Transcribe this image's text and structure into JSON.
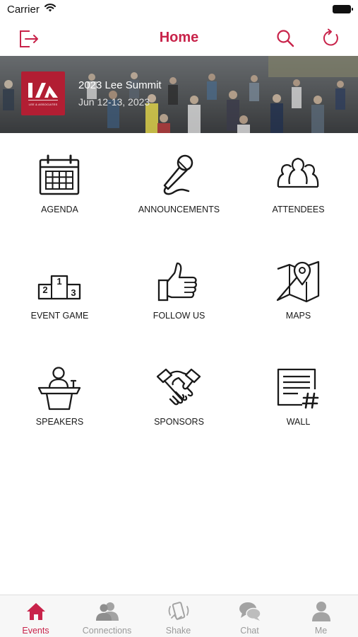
{
  "status_bar": {
    "carrier": "Carrier"
  },
  "nav": {
    "title": "Home"
  },
  "event": {
    "title": "2023 Lee Summit",
    "dates": "Jun 12-13, 2023",
    "logo_text": "LEE & ASSOCIATES"
  },
  "tiles": [
    {
      "label": "AGENDA",
      "icon": "calendar-icon"
    },
    {
      "label": "ANNOUNCEMENTS",
      "icon": "microphone-icon"
    },
    {
      "label": "ATTENDEES",
      "icon": "people-icon"
    },
    {
      "label": "EVENT GAME",
      "icon": "podium-icon"
    },
    {
      "label": "FOLLOW US",
      "icon": "thumbs-up-icon"
    },
    {
      "label": "MAPS",
      "icon": "map-pin-icon"
    },
    {
      "label": "SPEAKERS",
      "icon": "speaker-podium-icon"
    },
    {
      "label": "SPONSORS",
      "icon": "handshake-icon"
    },
    {
      "label": "WALL",
      "icon": "wall-post-icon"
    }
  ],
  "tab_bar": {
    "active": "Events",
    "items": [
      {
        "label": "Events",
        "icon": "home-icon"
      },
      {
        "label": "Connections",
        "icon": "connections-icon"
      },
      {
        "label": "Shake",
        "icon": "shake-phone-icon"
      },
      {
        "label": "Chat",
        "icon": "chat-icon"
      },
      {
        "label": "Me",
        "icon": "person-icon"
      }
    ]
  },
  "colors": {
    "accent": "#c8234a",
    "logo_bg": "#b21e33",
    "tab_inactive": "#9a9a9a"
  }
}
